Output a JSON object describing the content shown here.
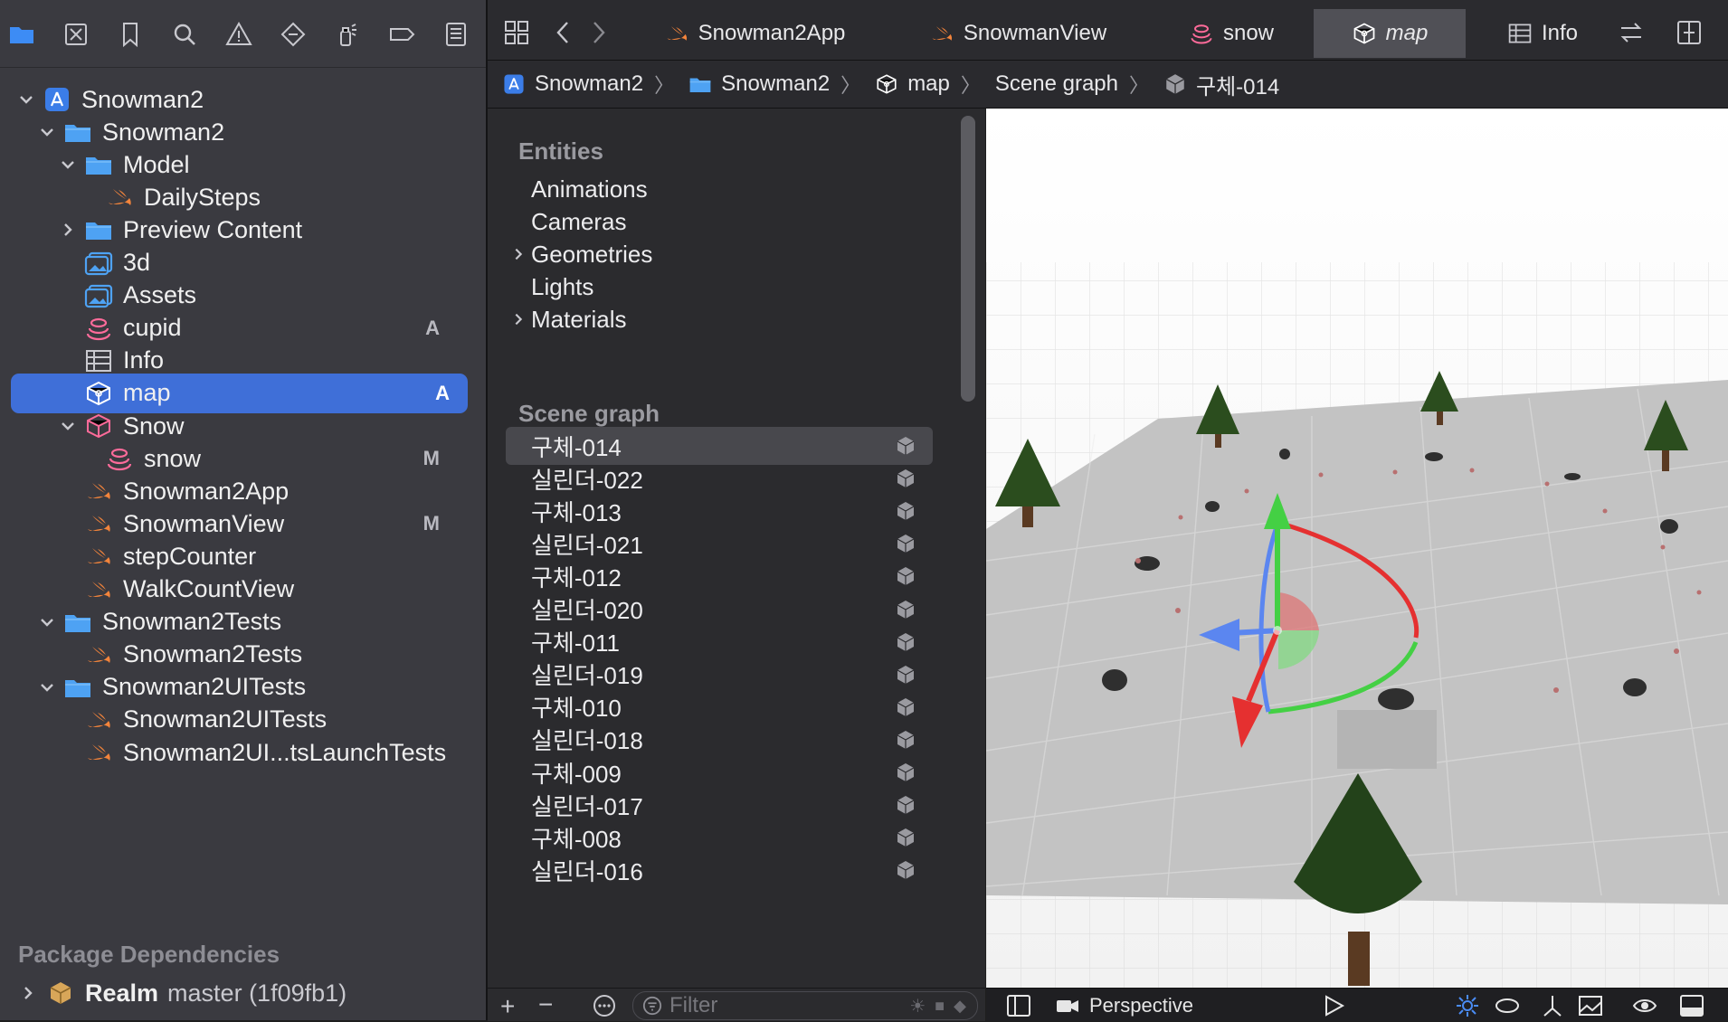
{
  "navigator": {
    "toolbar_icons": [
      "folder-icon",
      "source-control-icon",
      "bookmark-icon",
      "find-icon",
      "issue-warning-icon",
      "test-diamond-icon",
      "debug-spray-icon",
      "breakpoint-icon",
      "report-icon"
    ],
    "tree": [
      {
        "label": "Snowman2",
        "icon": "xcode-project-icon",
        "depth": 0,
        "expanded": true,
        "badge": ""
      },
      {
        "label": "Snowman2",
        "icon": "folder-icon",
        "depth": 1,
        "expanded": true,
        "badge": ""
      },
      {
        "label": "Model",
        "icon": "folder-icon",
        "depth": 2,
        "expanded": true,
        "badge": ""
      },
      {
        "label": "DailySteps",
        "icon": "swift-icon",
        "depth": 3,
        "expanded": null,
        "badge": ""
      },
      {
        "label": "Preview Content",
        "icon": "folder-icon",
        "depth": 2,
        "expanded": false,
        "badge": ""
      },
      {
        "label": "3d",
        "icon": "asset-catalog-icon",
        "depth": 2,
        "expanded": null,
        "badge": ""
      },
      {
        "label": "Assets",
        "icon": "asset-catalog-icon",
        "depth": 2,
        "expanded": null,
        "badge": ""
      },
      {
        "label": "cupid",
        "icon": "reality-file-icon",
        "depth": 2,
        "expanded": null,
        "badge": "A"
      },
      {
        "label": "Info",
        "icon": "plist-icon",
        "depth": 2,
        "expanded": null,
        "badge": ""
      },
      {
        "label": "map",
        "icon": "scene-cube-icon",
        "depth": 2,
        "expanded": null,
        "badge": "A",
        "selected": true
      },
      {
        "label": "Snow",
        "icon": "scene-folder-icon",
        "depth": 2,
        "expanded": true,
        "badge": ""
      },
      {
        "label": "snow",
        "icon": "reality-file-icon",
        "depth": 3,
        "expanded": null,
        "badge": "M"
      },
      {
        "label": "Snowman2App",
        "icon": "swift-icon",
        "depth": 2,
        "expanded": null,
        "badge": ""
      },
      {
        "label": "SnowmanView",
        "icon": "swift-icon",
        "depth": 2,
        "expanded": null,
        "badge": "M"
      },
      {
        "label": "stepCounter",
        "icon": "swift-icon",
        "depth": 2,
        "expanded": null,
        "badge": ""
      },
      {
        "label": "WalkCountView",
        "icon": "swift-icon",
        "depth": 2,
        "expanded": null,
        "badge": ""
      },
      {
        "label": "Snowman2Tests",
        "icon": "folder-icon",
        "depth": 1,
        "expanded": true,
        "badge": ""
      },
      {
        "label": "Snowman2Tests",
        "icon": "swift-icon",
        "depth": 2,
        "expanded": null,
        "badge": ""
      },
      {
        "label": "Snowman2UITests",
        "icon": "folder-icon",
        "depth": 1,
        "expanded": true,
        "badge": ""
      },
      {
        "label": "Snowman2UITests",
        "icon": "swift-icon",
        "depth": 2,
        "expanded": null,
        "badge": ""
      },
      {
        "label": "Snowman2UI...tsLaunchTests",
        "icon": "swift-icon",
        "depth": 2,
        "expanded": null,
        "badge": ""
      }
    ],
    "package_header": "Package Dependencies",
    "package": {
      "name": "Realm",
      "detail": "master (1f09fb1)"
    }
  },
  "tabs": [
    {
      "label": "Snowman2App",
      "icon": "swift-icon",
      "active": false
    },
    {
      "label": "SnowmanView",
      "icon": "swift-icon",
      "active": false
    },
    {
      "label": "snow",
      "icon": "reality-file-icon",
      "active": false
    },
    {
      "label": "map",
      "icon": "scene-cube-icon",
      "active": true
    },
    {
      "label": "Info",
      "icon": "plist-icon",
      "active": false
    }
  ],
  "jumpbar": [
    {
      "label": "Snowman2",
      "icon": "xcode-project-icon"
    },
    {
      "label": "Snowman2",
      "icon": "folder-icon"
    },
    {
      "label": "map",
      "icon": "scene-cube-icon"
    },
    {
      "label": "Scene graph",
      "icon": ""
    },
    {
      "label": "구체-014",
      "icon": "node-cube-icon"
    }
  ],
  "outline": {
    "entities_header": "Entities",
    "entities": [
      {
        "label": "Animations",
        "expandable": false
      },
      {
        "label": "Cameras",
        "expandable": false
      },
      {
        "label": "Geometries",
        "expandable": true
      },
      {
        "label": "Lights",
        "expandable": false
      },
      {
        "label": "Materials",
        "expandable": true
      }
    ],
    "scene_graph_header": "Scene graph",
    "nodes": [
      "구체-014",
      "실린더-022",
      "구체-013",
      "실린더-021",
      "구체-012",
      "실린더-020",
      "구체-011",
      "실린더-019",
      "구체-010",
      "실린더-018",
      "구체-009",
      "실린더-017",
      "구체-008",
      "실린더-016"
    ],
    "selected_node": "구체-014",
    "filter_placeholder": "Filter"
  },
  "scene_toolbar": {
    "camera": "Perspective"
  },
  "colors": {
    "selection": "#3f6fd8",
    "swift": "#f3843b",
    "folder": "#4ea2f3",
    "reality": "#ff6b9a",
    "axis_x": "#e53030",
    "axis_y": "#49d049",
    "axis_z": "#5b86f0",
    "tree": "#1f3f1a"
  }
}
